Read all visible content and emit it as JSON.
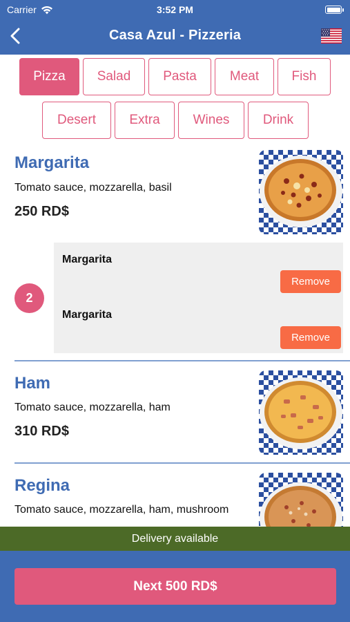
{
  "status": {
    "carrier": "Carrier",
    "time": "3:52 PM"
  },
  "nav": {
    "title": "Casa Azul - Pizzeria"
  },
  "categories": [
    "Pizza",
    "Salad",
    "Pasta",
    "Meat",
    "Fish",
    "Desert",
    "Extra",
    "Wines",
    "Drink"
  ],
  "active_category": "Pizza",
  "items": [
    {
      "name": "Margarita",
      "desc": "Tomato sauce, mozzarella, basil",
      "price": "250 RD$"
    },
    {
      "name": "Ham",
      "desc": "Tomato sauce, mozzarella, ham",
      "price": "310 RD$"
    },
    {
      "name": "Regina",
      "desc": "Tomato sauce, mozzarella, ham, mushroom",
      "price": ""
    }
  ],
  "order": {
    "quantity": "2",
    "lines": [
      {
        "name": "Margarita",
        "action": "Remove"
      },
      {
        "name": "Margarita",
        "action": "Remove"
      }
    ]
  },
  "delivery_text": "Delivery available",
  "next_button": "Next 500 RD$",
  "colors": {
    "primary": "#3f6bb3",
    "accent": "#e0597c",
    "remove": "#f86b45",
    "delivery": "#4c6a27"
  }
}
